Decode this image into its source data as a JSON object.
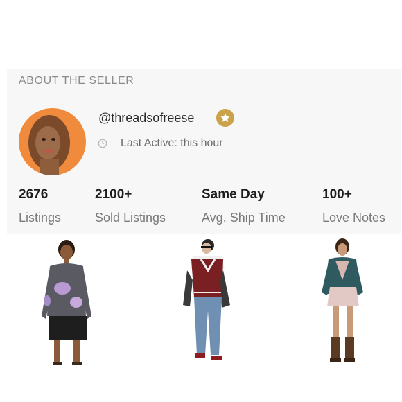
{
  "section_title": "ABOUT THE SELLER",
  "seller": {
    "username": "@threadsofreese",
    "last_active": "Last Active: this hour",
    "badge_icon": "star-icon",
    "avatar_bg": "#f08a3c"
  },
  "stats": [
    {
      "value": "2676",
      "label": "Listings"
    },
    {
      "value": "2100+",
      "label": "Sold Listings"
    },
    {
      "value": "Same Day",
      "label": "Avg. Ship Time"
    },
    {
      "value": "100+",
      "label": "Love Notes"
    }
  ],
  "products": [
    {
      "name": "product-1"
    },
    {
      "name": "product-2"
    },
    {
      "name": "product-3"
    }
  ],
  "colors": {
    "badge_gold": "#c9a24a",
    "card_bg": "#f8f7f7"
  }
}
